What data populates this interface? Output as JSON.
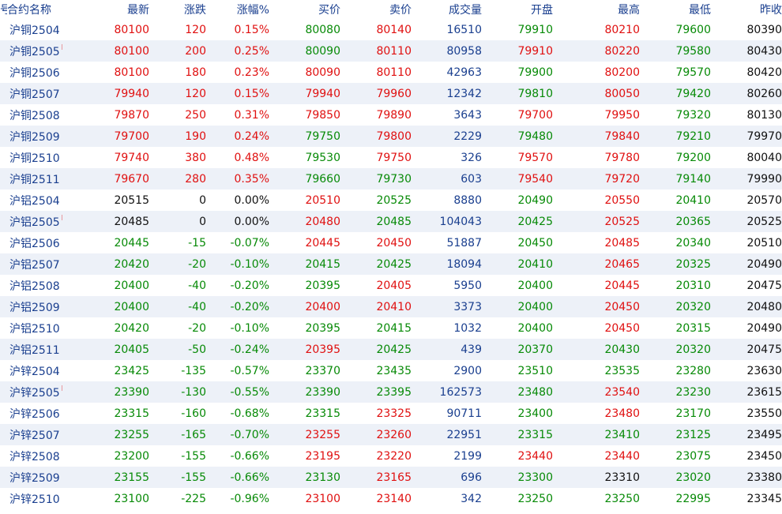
{
  "colors": {
    "up": "#e01010",
    "down": "#078a07",
    "flat": "#111111",
    "text_blue": "#1a3f8f",
    "row_alt": "#edf1f8"
  },
  "header": {
    "index": "号",
    "symbol": "合约名称",
    "last": "最新",
    "change": "涨跌",
    "change_pct": "涨幅%",
    "bid": "买价",
    "ask": "卖价",
    "volume": "成交量",
    "open": "开盘",
    "high": "最高",
    "low": "最低",
    "prev_close": "昨收"
  },
  "main_marker": "M",
  "rows": [
    {
      "symbol": "沪铜2504",
      "main": false,
      "last": "80100",
      "change": "120",
      "change_pct": "0.15%",
      "bid": "80080",
      "ask": "80140",
      "volume": "16510",
      "open": "79910",
      "high": "80210",
      "low": "79600",
      "prev_close": "80390",
      "c": {
        "last": "up",
        "change": "up",
        "change_pct": "up",
        "bid": "dn",
        "ask": "up",
        "open": "dn",
        "high": "up",
        "low": "dn"
      }
    },
    {
      "symbol": "沪铜2505",
      "main": true,
      "last": "80100",
      "change": "200",
      "change_pct": "0.25%",
      "bid": "80090",
      "ask": "80110",
      "volume": "80958",
      "open": "79910",
      "high": "80220",
      "low": "79580",
      "prev_close": "80430",
      "c": {
        "last": "up",
        "change": "up",
        "change_pct": "up",
        "bid": "dn",
        "ask": "up",
        "open": "up",
        "high": "up",
        "low": "dn"
      }
    },
    {
      "symbol": "沪铜2506",
      "main": false,
      "last": "80100",
      "change": "180",
      "change_pct": "0.23%",
      "bid": "80090",
      "ask": "80110",
      "volume": "42963",
      "open": "79900",
      "high": "80200",
      "low": "79570",
      "prev_close": "80420",
      "c": {
        "last": "up",
        "change": "up",
        "change_pct": "up",
        "bid": "up",
        "ask": "up",
        "open": "dn",
        "high": "up",
        "low": "dn"
      }
    },
    {
      "symbol": "沪铜2507",
      "main": false,
      "last": "79940",
      "change": "120",
      "change_pct": "0.15%",
      "bid": "79940",
      "ask": "79960",
      "volume": "12342",
      "open": "79810",
      "high": "80050",
      "low": "79420",
      "prev_close": "80260",
      "c": {
        "last": "up",
        "change": "up",
        "change_pct": "up",
        "bid": "up",
        "ask": "up",
        "open": "dn",
        "high": "up",
        "low": "dn"
      }
    },
    {
      "symbol": "沪铜2508",
      "main": false,
      "last": "79870",
      "change": "250",
      "change_pct": "0.31%",
      "bid": "79850",
      "ask": "79890",
      "volume": "3643",
      "open": "79700",
      "high": "79950",
      "low": "79320",
      "prev_close": "80130",
      "c": {
        "last": "up",
        "change": "up",
        "change_pct": "up",
        "bid": "up",
        "ask": "up",
        "open": "up",
        "high": "up",
        "low": "dn"
      }
    },
    {
      "symbol": "沪铜2509",
      "main": false,
      "last": "79700",
      "change": "190",
      "change_pct": "0.24%",
      "bid": "79750",
      "ask": "79800",
      "volume": "2229",
      "open": "79480",
      "high": "79840",
      "low": "79210",
      "prev_close": "79970",
      "c": {
        "last": "up",
        "change": "up",
        "change_pct": "up",
        "bid": "dn",
        "ask": "up",
        "open": "dn",
        "high": "up",
        "low": "dn"
      }
    },
    {
      "symbol": "沪铜2510",
      "main": false,
      "last": "79740",
      "change": "380",
      "change_pct": "0.48%",
      "bid": "79530",
      "ask": "79750",
      "volume": "326",
      "open": "79570",
      "high": "79780",
      "low": "79200",
      "prev_close": "80040",
      "c": {
        "last": "up",
        "change": "up",
        "change_pct": "up",
        "bid": "dn",
        "ask": "up",
        "open": "up",
        "high": "up",
        "low": "dn"
      }
    },
    {
      "symbol": "沪铜2511",
      "main": false,
      "last": "79670",
      "change": "280",
      "change_pct": "0.35%",
      "bid": "79660",
      "ask": "79730",
      "volume": "603",
      "open": "79540",
      "high": "79720",
      "low": "79140",
      "prev_close": "79990",
      "c": {
        "last": "up",
        "change": "up",
        "change_pct": "up",
        "bid": "dn",
        "ask": "dn",
        "open": "up",
        "high": "up",
        "low": "dn"
      }
    },
    {
      "symbol": "沪铝2504",
      "main": false,
      "last": "20515",
      "change": "0",
      "change_pct": "0.00%",
      "bid": "20510",
      "ask": "20525",
      "volume": "8880",
      "open": "20490",
      "high": "20550",
      "low": "20410",
      "prev_close": "20570",
      "c": {
        "last": "eq",
        "change": "eq",
        "change_pct": "eq",
        "bid": "up",
        "ask": "dn",
        "open": "dn",
        "high": "up",
        "low": "dn"
      }
    },
    {
      "symbol": "沪铝2505",
      "main": true,
      "last": "20485",
      "change": "0",
      "change_pct": "0.00%",
      "bid": "20480",
      "ask": "20485",
      "volume": "104043",
      "open": "20425",
      "high": "20525",
      "low": "20365",
      "prev_close": "20525",
      "c": {
        "last": "eq",
        "change": "eq",
        "change_pct": "eq",
        "bid": "up",
        "ask": "dn",
        "open": "dn",
        "high": "up",
        "low": "dn"
      }
    },
    {
      "symbol": "沪铝2506",
      "main": false,
      "last": "20445",
      "change": "-15",
      "change_pct": "-0.07%",
      "bid": "20445",
      "ask": "20450",
      "volume": "51887",
      "open": "20450",
      "high": "20485",
      "low": "20340",
      "prev_close": "20510",
      "c": {
        "last": "dn",
        "change": "dn",
        "change_pct": "dn",
        "bid": "up",
        "ask": "up",
        "open": "dn",
        "high": "up",
        "low": "dn"
      }
    },
    {
      "symbol": "沪铝2507",
      "main": false,
      "last": "20420",
      "change": "-20",
      "change_pct": "-0.10%",
      "bid": "20415",
      "ask": "20425",
      "volume": "18094",
      "open": "20410",
      "high": "20465",
      "low": "20325",
      "prev_close": "20490",
      "c": {
        "last": "dn",
        "change": "dn",
        "change_pct": "dn",
        "bid": "dn",
        "ask": "dn",
        "open": "dn",
        "high": "up",
        "low": "dn"
      }
    },
    {
      "symbol": "沪铝2508",
      "main": false,
      "last": "20400",
      "change": "-40",
      "change_pct": "-0.20%",
      "bid": "20395",
      "ask": "20405",
      "volume": "5950",
      "open": "20400",
      "high": "20445",
      "low": "20310",
      "prev_close": "20475",
      "c": {
        "last": "dn",
        "change": "dn",
        "change_pct": "dn",
        "bid": "dn",
        "ask": "up",
        "open": "dn",
        "high": "up",
        "low": "dn"
      }
    },
    {
      "symbol": "沪铝2509",
      "main": false,
      "last": "20400",
      "change": "-40",
      "change_pct": "-0.20%",
      "bid": "20400",
      "ask": "20410",
      "volume": "3373",
      "open": "20400",
      "high": "20450",
      "low": "20320",
      "prev_close": "20480",
      "c": {
        "last": "dn",
        "change": "dn",
        "change_pct": "dn",
        "bid": "up",
        "ask": "up",
        "open": "dn",
        "high": "up",
        "low": "dn"
      }
    },
    {
      "symbol": "沪铝2510",
      "main": false,
      "last": "20420",
      "change": "-20",
      "change_pct": "-0.10%",
      "bid": "20395",
      "ask": "20415",
      "volume": "1032",
      "open": "20400",
      "high": "20450",
      "low": "20315",
      "prev_close": "20490",
      "c": {
        "last": "dn",
        "change": "dn",
        "change_pct": "dn",
        "bid": "dn",
        "ask": "dn",
        "open": "dn",
        "high": "up",
        "low": "dn"
      }
    },
    {
      "symbol": "沪铝2511",
      "main": false,
      "last": "20405",
      "change": "-50",
      "change_pct": "-0.24%",
      "bid": "20395",
      "ask": "20425",
      "volume": "439",
      "open": "20370",
      "high": "20430",
      "low": "20320",
      "prev_close": "20475",
      "c": {
        "last": "dn",
        "change": "dn",
        "change_pct": "dn",
        "bid": "up",
        "ask": "dn",
        "open": "dn",
        "high": "dn",
        "low": "dn"
      }
    },
    {
      "symbol": "沪锌2504",
      "main": false,
      "last": "23425",
      "change": "-135",
      "change_pct": "-0.57%",
      "bid": "23370",
      "ask": "23435",
      "volume": "2900",
      "open": "23510",
      "high": "23535",
      "low": "23280",
      "prev_close": "23630",
      "c": {
        "last": "dn",
        "change": "dn",
        "change_pct": "dn",
        "bid": "dn",
        "ask": "dn",
        "open": "dn",
        "high": "dn",
        "low": "dn"
      }
    },
    {
      "symbol": "沪锌2505",
      "main": true,
      "last": "23390",
      "change": "-130",
      "change_pct": "-0.55%",
      "bid": "23390",
      "ask": "23395",
      "volume": "162573",
      "open": "23480",
      "high": "23540",
      "low": "23230",
      "prev_close": "23615",
      "c": {
        "last": "dn",
        "change": "dn",
        "change_pct": "dn",
        "bid": "dn",
        "ask": "dn",
        "open": "dn",
        "high": "up",
        "low": "dn"
      }
    },
    {
      "symbol": "沪锌2506",
      "main": false,
      "last": "23315",
      "change": "-160",
      "change_pct": "-0.68%",
      "bid": "23315",
      "ask": "23325",
      "volume": "90711",
      "open": "23400",
      "high": "23480",
      "low": "23170",
      "prev_close": "23550",
      "c": {
        "last": "dn",
        "change": "dn",
        "change_pct": "dn",
        "bid": "dn",
        "ask": "up",
        "open": "dn",
        "high": "up",
        "low": "dn"
      }
    },
    {
      "symbol": "沪锌2507",
      "main": false,
      "last": "23255",
      "change": "-165",
      "change_pct": "-0.70%",
      "bid": "23255",
      "ask": "23260",
      "volume": "22951",
      "open": "23315",
      "high": "23410",
      "low": "23125",
      "prev_close": "23495",
      "c": {
        "last": "dn",
        "change": "dn",
        "change_pct": "dn",
        "bid": "up",
        "ask": "up",
        "open": "dn",
        "high": "dn",
        "low": "dn"
      }
    },
    {
      "symbol": "沪锌2508",
      "main": false,
      "last": "23200",
      "change": "-155",
      "change_pct": "-0.66%",
      "bid": "23195",
      "ask": "23220",
      "volume": "2199",
      "open": "23440",
      "high": "23440",
      "low": "23075",
      "prev_close": "23450",
      "c": {
        "last": "dn",
        "change": "dn",
        "change_pct": "dn",
        "bid": "up",
        "ask": "up",
        "open": "up",
        "high": "up",
        "low": "dn"
      }
    },
    {
      "symbol": "沪锌2509",
      "main": false,
      "last": "23155",
      "change": "-155",
      "change_pct": "-0.66%",
      "bid": "23130",
      "ask": "23165",
      "volume": "696",
      "open": "23300",
      "high": "23310",
      "low": "23020",
      "prev_close": "23380",
      "c": {
        "last": "dn",
        "change": "dn",
        "change_pct": "dn",
        "bid": "dn",
        "ask": "up",
        "open": "dn",
        "high": "eq",
        "low": "dn"
      }
    },
    {
      "symbol": "沪锌2510",
      "main": false,
      "last": "23100",
      "change": "-225",
      "change_pct": "-0.96%",
      "bid": "23100",
      "ask": "23140",
      "volume": "342",
      "open": "23250",
      "high": "23250",
      "low": "22995",
      "prev_close": "23345",
      "c": {
        "last": "dn",
        "change": "dn",
        "change_pct": "dn",
        "bid": "up",
        "ask": "up",
        "open": "dn",
        "high": "dn",
        "low": "dn"
      }
    }
  ]
}
